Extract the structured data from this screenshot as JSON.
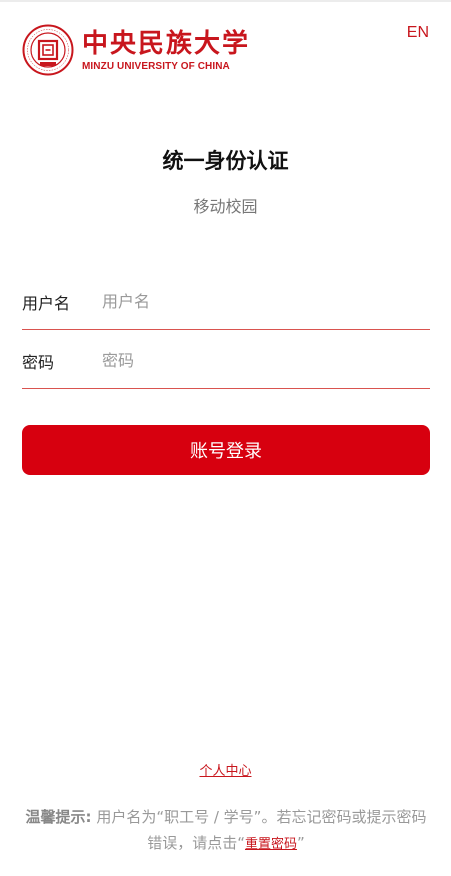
{
  "header": {
    "logo_cn": "中央民族大学",
    "logo_en": "MINZU UNIVERSITY OF CHINA",
    "lang_switch": "EN"
  },
  "title": "统一身份认证",
  "subtitle": "移动校园",
  "form": {
    "username_label": "用户名",
    "username_placeholder": "用户名",
    "password_label": "密码",
    "password_placeholder": "密码",
    "login_button": "账号登录"
  },
  "footer": {
    "personal_center": "个人中心",
    "tip_label": "温馨提示:",
    "tip_text": "用户名为“职工号 / 学号”。若忘记密码或提示密码错误，请点击“",
    "reset_link": "重置密码",
    "tip_end": "”"
  },
  "colors": {
    "brand": "#c8161d",
    "button": "#d7000f"
  },
  "icons": {
    "seal": "university-seal-icon"
  }
}
